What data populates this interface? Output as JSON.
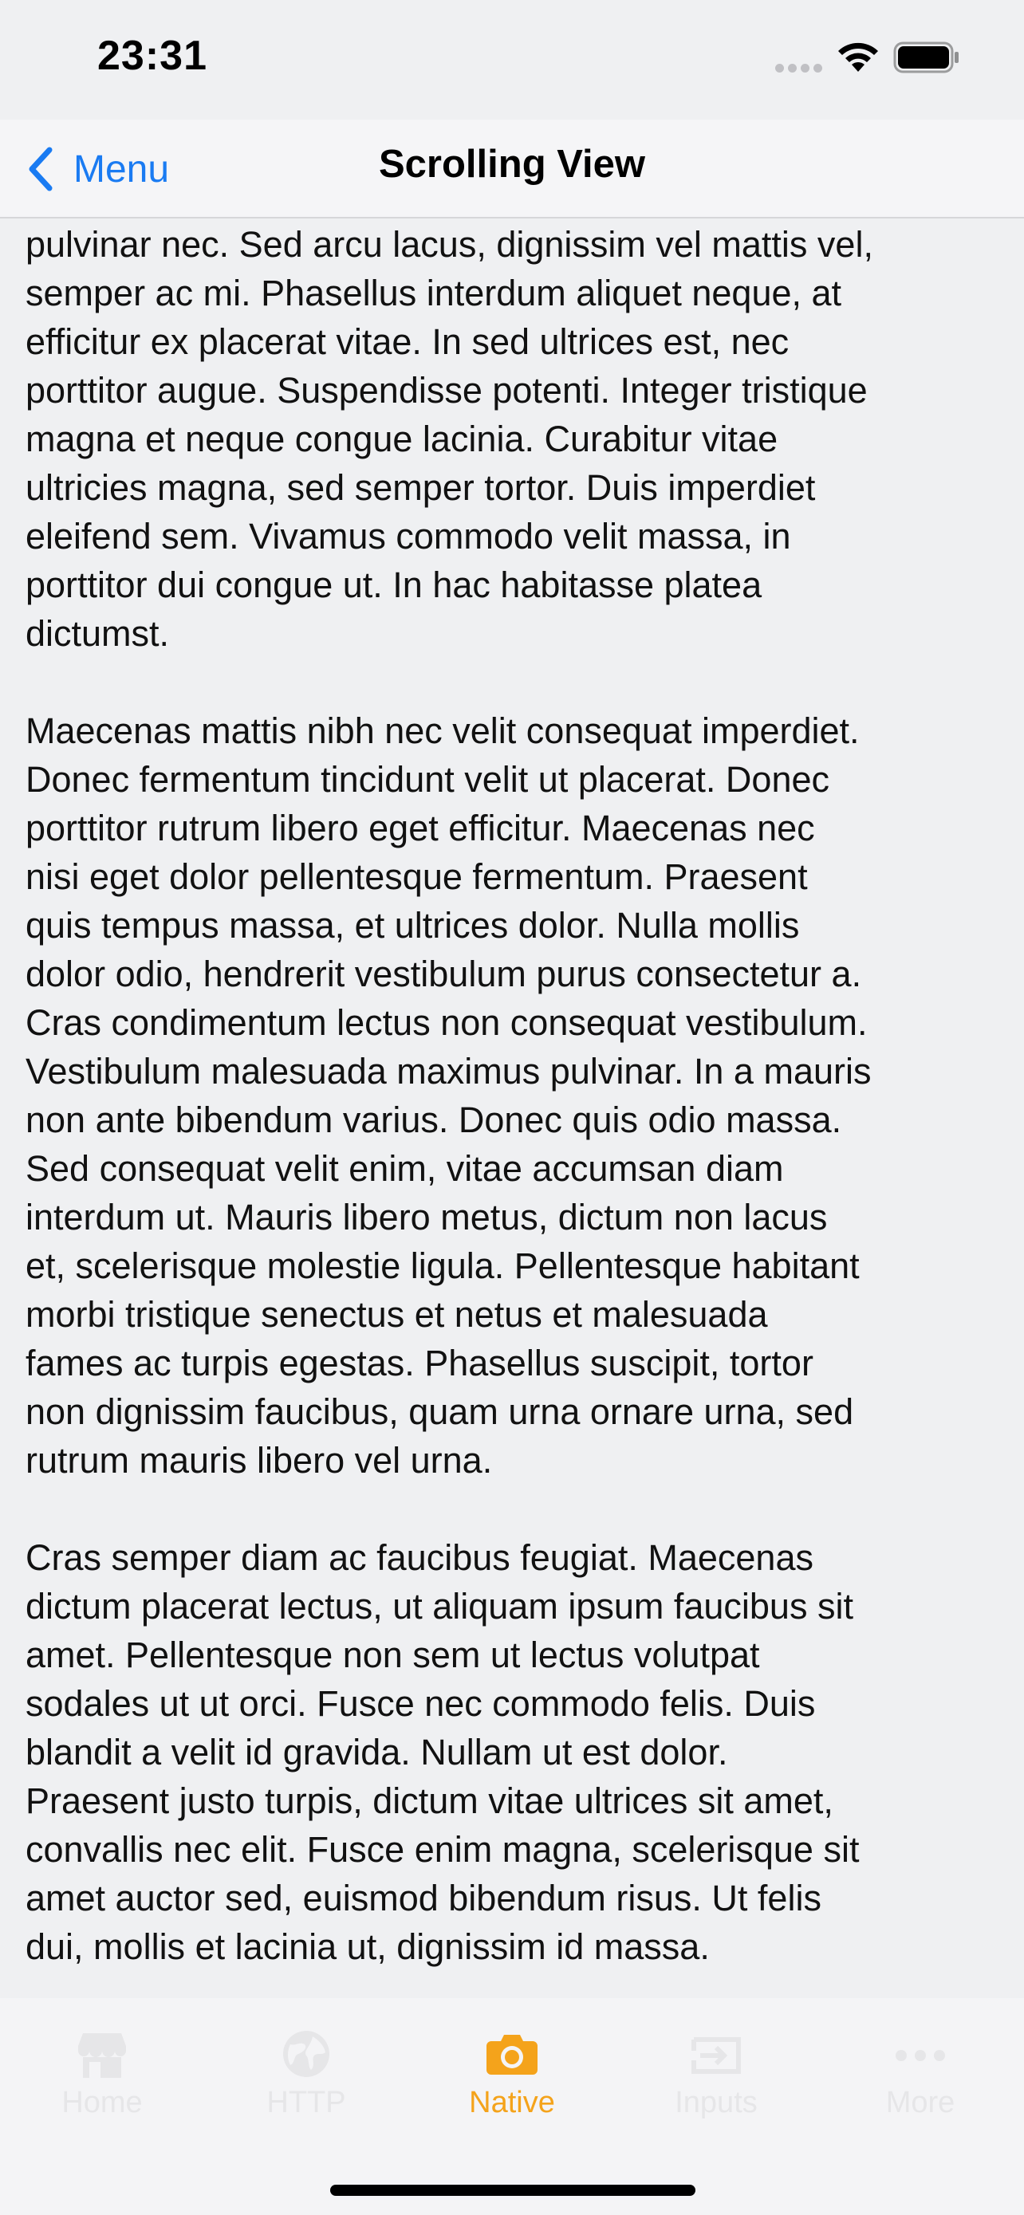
{
  "status_bar": {
    "time": "23:31"
  },
  "nav": {
    "back_label": "Menu",
    "title": "Scrolling View",
    "accent_color": "#1a7bf2"
  },
  "content": {
    "paragraphs": [
      "pulvinar nec. Sed arcu lacus, dignissim vel mattis vel,\nsemper ac mi. Phasellus interdum aliquet neque, at\nefficitur ex placerat vitae. In sed ultrices est, nec\nporttitor augue. Suspendisse potenti. Integer tristique\nmagna et neque congue lacinia. Curabitur vitae\nultricies magna, sed semper tortor. Duis imperdiet\neleifend sem. Vivamus commodo velit massa, in\nporttitor dui congue ut. In hac habitasse platea\ndictumst.",
      "Maecenas mattis nibh nec velit consequat imperdiet.\nDonec fermentum tincidunt velit ut placerat. Donec\nporttitor rutrum libero eget efficitur. Maecenas nec\nnisi eget dolor pellentesque fermentum. Praesent\nquis tempus massa, et ultrices dolor. Nulla mollis\ndolor odio, hendrerit vestibulum purus consectetur a.\nCras condimentum lectus non consequat vestibulum.\nVestibulum malesuada maximus pulvinar. In a mauris\nnon ante bibendum varius. Donec quis odio massa.\nSed consequat velit enim, vitae accumsan diam\ninterdum ut. Mauris libero metus, dictum non lacus\net, scelerisque molestie ligula. Pellentesque habitant\nmorbi tristique senectus et netus et malesuada\nfames ac turpis egestas. Phasellus suscipit, tortor\nnon dignissim faucibus, quam urna ornare urna, sed\nrutrum mauris libero vel urna.",
      "Cras semper diam ac faucibus feugiat. Maecenas\ndictum placerat lectus, ut aliquam ipsum faucibus sit\namet. Pellentesque non sem ut lectus volutpat\nsodales ut ut orci. Fusce nec commodo felis. Duis\nblandit a velit id gravida. Nullam ut est dolor.\nPraesent justo turpis, dictum vitae ultrices sit amet,\nconvallis nec elit. Fusce enim magna, scelerisque sit\namet auctor sed, euismod bibendum risus. Ut felis\ndui, mollis et lacinia ut, dignissim id massa."
    ]
  },
  "tab_bar": {
    "active_color": "#f4a31b",
    "inactive_color": "#e6e6e8",
    "tabs": [
      {
        "label": "Home",
        "icon": "store-icon",
        "active": false
      },
      {
        "label": "HTTP",
        "icon": "globe-icon",
        "active": false
      },
      {
        "label": "Native",
        "icon": "camera-icon",
        "active": true
      },
      {
        "label": "Inputs",
        "icon": "input-arrow-icon",
        "active": false
      },
      {
        "label": "More",
        "icon": "more-dots-icon",
        "active": false
      }
    ]
  }
}
